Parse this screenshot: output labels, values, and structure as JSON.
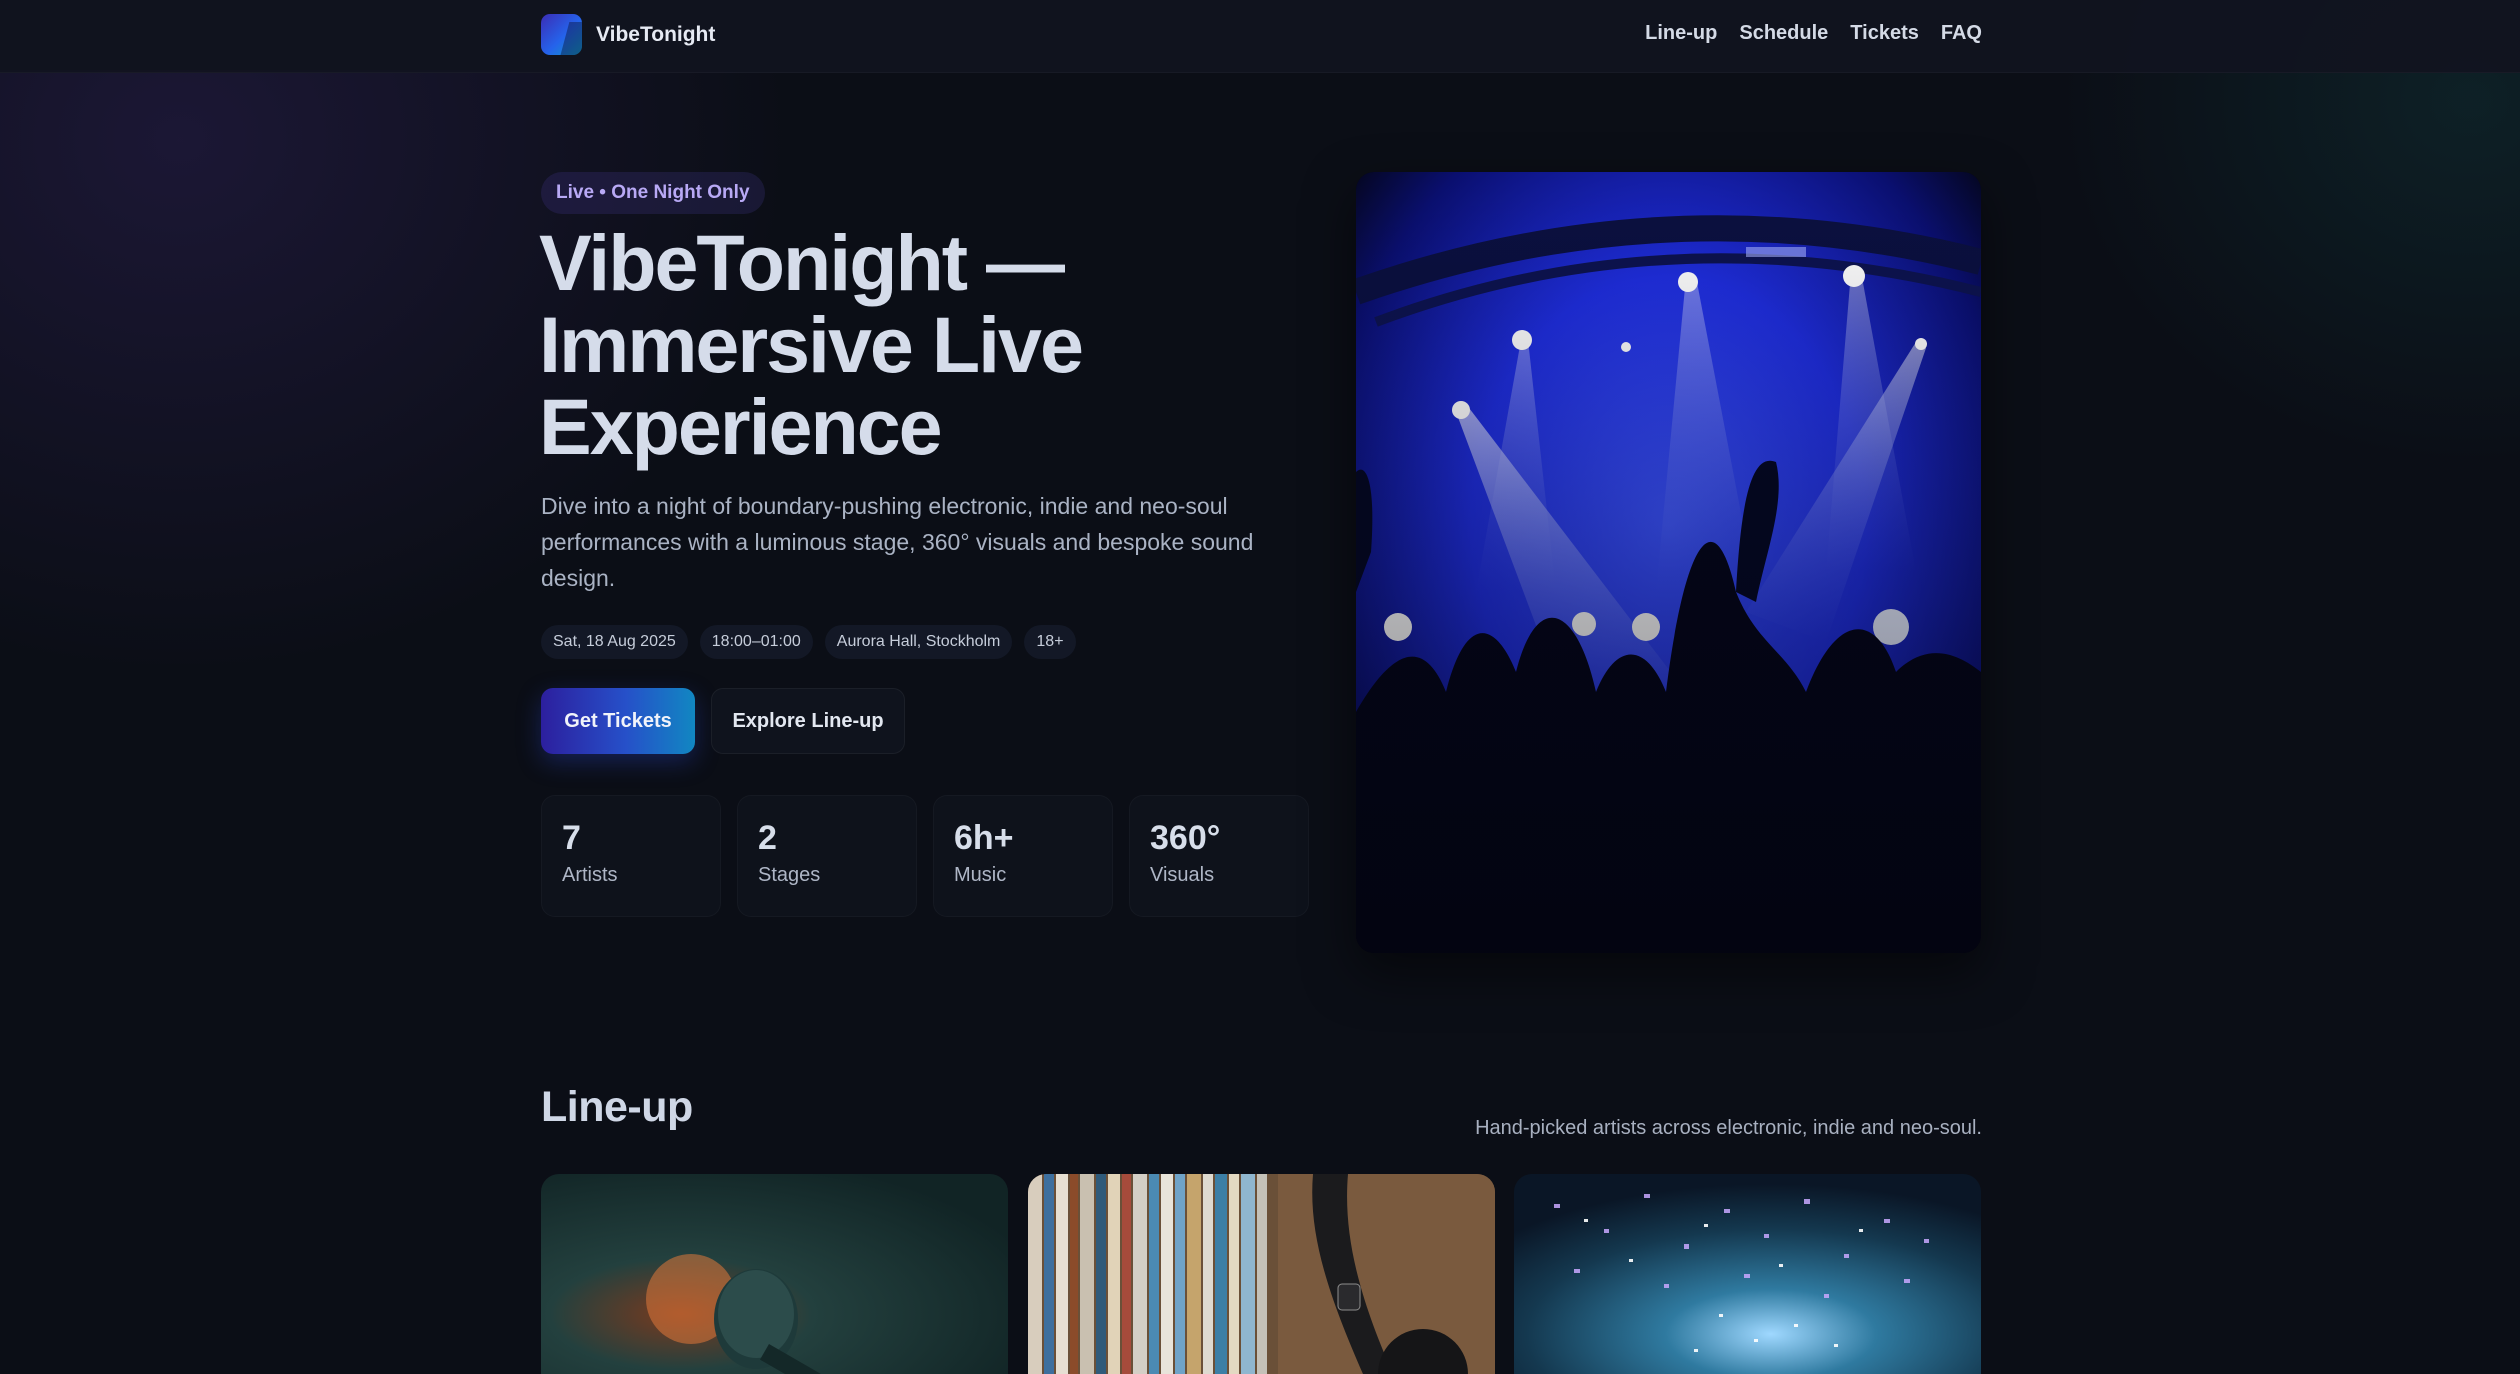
{
  "header": {
    "brand": "VibeTonight",
    "nav": [
      "Line-up",
      "Schedule",
      "Tickets",
      "FAQ"
    ]
  },
  "hero": {
    "badge": "Live • One Night Only",
    "title_line1": "VibeTonight —",
    "title_line2": "Immersive Live",
    "title_line3": "Experience",
    "description": "Dive into a night of boundary-pushing electronic, indie and neo-soul performances with a luminous stage, 360° visuals and bespoke sound design.",
    "chips": [
      "Sat, 18 Aug 2025",
      "18:00–01:00",
      "Aurora Hall, Stockholm",
      "18+"
    ],
    "primary_cta": "Get Tickets",
    "secondary_cta": "Explore Line-up",
    "stats": [
      {
        "value": "7",
        "label": "Artists"
      },
      {
        "value": "2",
        "label": "Stages"
      },
      {
        "value": "6h+",
        "label": "Music"
      },
      {
        "value": "360°",
        "label": "Visuals"
      }
    ]
  },
  "lineup": {
    "title": "Line-up",
    "subtitle": "Hand-picked artists across electronic, indie and neo-soul."
  },
  "colors": {
    "background": "#0b0e16",
    "accent_start": "#2c1f9e",
    "accent_end": "#1187c2",
    "badge_text": "#b8a9f5"
  }
}
